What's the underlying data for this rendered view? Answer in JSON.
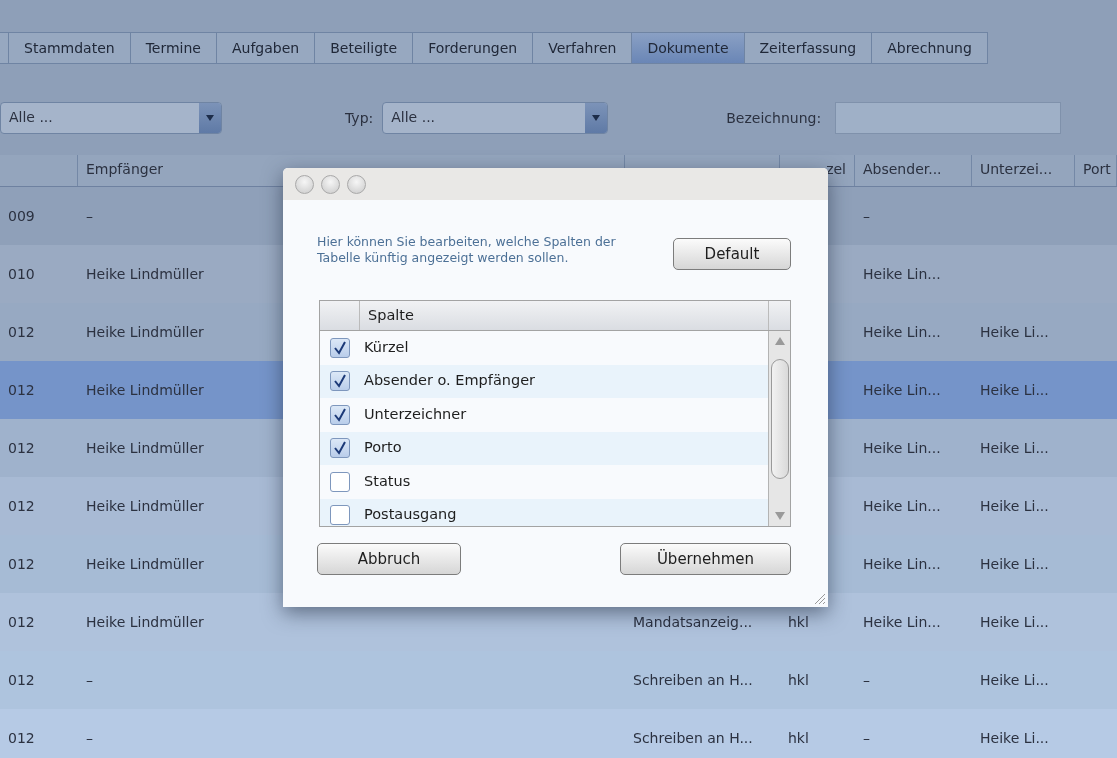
{
  "tabs": [
    {
      "selected": false
    },
    {
      "label": "Stammdaten",
      "selected": false
    },
    {
      "label": "Termine",
      "selected": false
    },
    {
      "label": "Aufgaben",
      "selected": false
    },
    {
      "label": "Beteiligte",
      "selected": false
    },
    {
      "label": "Forderungen",
      "selected": false
    },
    {
      "label": "Verfahren",
      "selected": false
    },
    {
      "label": "Dokumente",
      "selected": true
    },
    {
      "label": "Zeiterfassung",
      "selected": false
    },
    {
      "label": "Abrechnung",
      "selected": false
    }
  ],
  "filters": {
    "combo_1": {
      "value": "Alle ..."
    },
    "type_label": "Typ:",
    "type_combo": {
      "value": "Alle ..."
    },
    "name_label": "Bezeichnung:"
  },
  "table": {
    "columns": [
      null,
      "Empfänger",
      null,
      "zel",
      "Absender...",
      "Unterzei...",
      "Port"
    ],
    "rows": [
      {
        "selected": false,
        "cells": [
          "009",
          "–",
          "",
          "",
          "–",
          ""
        ]
      },
      {
        "selected": false,
        "cells": [
          "010",
          "Heike Lindmüller",
          "",
          "",
          "Heike Lin...",
          ""
        ]
      },
      {
        "selected": false,
        "cells": [
          "012",
          "Heike Lindmüller",
          "",
          "",
          "Heike Lin...",
          "Heike Li..."
        ]
      },
      {
        "selected": true,
        "cells": [
          "012",
          "Heike Lindmüller",
          "",
          "",
          "Heike Lin...",
          "Heike Li..."
        ]
      },
      {
        "selected": false,
        "cells": [
          "012",
          "Heike Lindmüller",
          "",
          "",
          "Heike Lin...",
          "Heike Li..."
        ]
      },
      {
        "selected": false,
        "cells": [
          "012",
          "Heike Lindmüller",
          "",
          "",
          "Heike Lin...",
          "Heike Li..."
        ]
      },
      {
        "selected": false,
        "cells": [
          "012",
          "Heike Lindmüller",
          "",
          "",
          "Heike Lin...",
          "Heike Li..."
        ]
      },
      {
        "selected": false,
        "cells": [
          "012",
          "Heike Lindmüller",
          "Mandatsanzeig...",
          "hkl",
          "Heike Lin...",
          "Heike Li..."
        ]
      },
      {
        "selected": false,
        "cells": [
          "012",
          "–",
          "Schreiben an H...",
          "hkl",
          "–",
          "Heike Li..."
        ]
      },
      {
        "selected": false,
        "cells": [
          "012",
          "–",
          "Schreiben an H...",
          "hkl",
          "–",
          "Heike Li..."
        ]
      }
    ]
  },
  "dialog": {
    "message": "Hier können Sie bearbeiten, welche Spalten der Tabelle künftig angezeigt werden sollen.",
    "default_button": "Default",
    "list_header": "Spalte",
    "items": [
      {
        "label": "Kürzel",
        "checked": true
      },
      {
        "label": "Absender o. Empfänger",
        "checked": true
      },
      {
        "label": "Unterzeichner",
        "checked": true
      },
      {
        "label": "Porto",
        "checked": true
      },
      {
        "label": "Status",
        "checked": false
      },
      {
        "label": "Postausgang",
        "checked": false
      }
    ],
    "buttons": [
      "Abbruch",
      "Übernehmen"
    ]
  }
}
